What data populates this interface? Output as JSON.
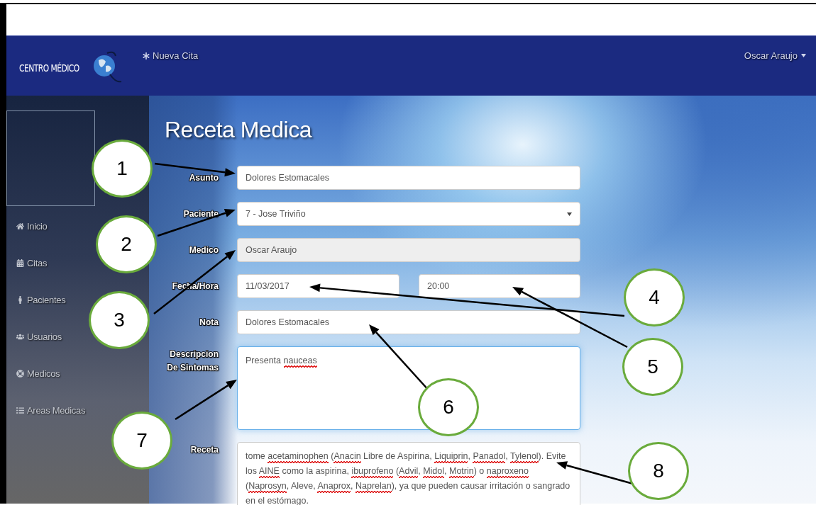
{
  "navbar": {
    "brand": "CENTRO MÉDICO",
    "links": [
      {
        "label": "Nueva Cita"
      }
    ],
    "user": "Oscar Araujo"
  },
  "sidebar": {
    "items": [
      {
        "label": "Inicio"
      },
      {
        "label": "Citas"
      },
      {
        "label": "Pacientes"
      },
      {
        "label": "Usuarios"
      },
      {
        "label": "Medicos"
      },
      {
        "label": "Areas Medicas"
      }
    ]
  },
  "form": {
    "title": "Receta Medica",
    "fields": [
      {
        "kind": "text",
        "label": "Asunto",
        "value": "Dolores Estomacales",
        "disabled": false
      },
      {
        "kind": "select",
        "label": "Paciente",
        "value": "7 - Jose Triviño",
        "disabled": false
      },
      {
        "kind": "text",
        "label": "Medico",
        "value": "Oscar Araujo",
        "disabled": true
      },
      {
        "kind": "datetime",
        "label": "Fecha/Hora",
        "date": "11/03/2017",
        "time": "20:00",
        "disabled": false
      },
      {
        "kind": "text",
        "label": "Nota",
        "value": "Dolores Estomacales",
        "disabled": false
      },
      {
        "kind": "textarea",
        "label": "Descripcion De Sintomas",
        "focused": true,
        "segments": [
          {
            "text": "Presenta ",
            "misspelled": false
          },
          {
            "text": "nauceas",
            "misspelled": true
          }
        ]
      },
      {
        "kind": "textarea",
        "label": "Receta",
        "focused": false,
        "segments": [
          {
            "text": "tome ",
            "misspelled": false
          },
          {
            "text": "acetaminophen",
            "misspelled": true
          },
          {
            "text": " (",
            "misspelled": false
          },
          {
            "text": "Anacin",
            "misspelled": true
          },
          {
            "text": " Libre de Aspirina, ",
            "misspelled": false
          },
          {
            "text": "Liquiprin",
            "misspelled": true
          },
          {
            "text": ", ",
            "misspelled": false
          },
          {
            "text": "Panadol",
            "misspelled": true
          },
          {
            "text": ", ",
            "misspelled": false
          },
          {
            "text": "Tylenol",
            "misspelled": true
          },
          {
            "text": "). Evite los ",
            "misspelled": false
          },
          {
            "text": "AINE",
            "misspelled": true
          },
          {
            "text": " como la aspirina, ",
            "misspelled": false
          },
          {
            "text": "ibuprofeno",
            "misspelled": true
          },
          {
            "text": " (",
            "misspelled": false
          },
          {
            "text": "Advil",
            "misspelled": true
          },
          {
            "text": ", ",
            "misspelled": false
          },
          {
            "text": "Midol",
            "misspelled": true
          },
          {
            "text": ", ",
            "misspelled": false
          },
          {
            "text": "Motrin",
            "misspelled": true
          },
          {
            "text": ") o ",
            "misspelled": false
          },
          {
            "text": "naproxeno",
            "misspelled": true
          },
          {
            "text": " (",
            "misspelled": false
          },
          {
            "text": "Naprosyn",
            "misspelled": true
          },
          {
            "text": ", Aleve, ",
            "misspelled": false
          },
          {
            "text": "Anaprox",
            "misspelled": true
          },
          {
            "text": ", ",
            "misspelled": false
          },
          {
            "text": "Naprelan",
            "misspelled": true
          },
          {
            "text": "), ya que pueden causar irritación o sangrado en el estómago.",
            "misspelled": false
          }
        ]
      }
    ]
  },
  "annotations": [
    {
      "label": "1"
    },
    {
      "label": "2"
    },
    {
      "label": "3"
    },
    {
      "label": "4"
    },
    {
      "label": "5"
    },
    {
      "label": "6"
    },
    {
      "label": "7"
    },
    {
      "label": "8"
    }
  ]
}
